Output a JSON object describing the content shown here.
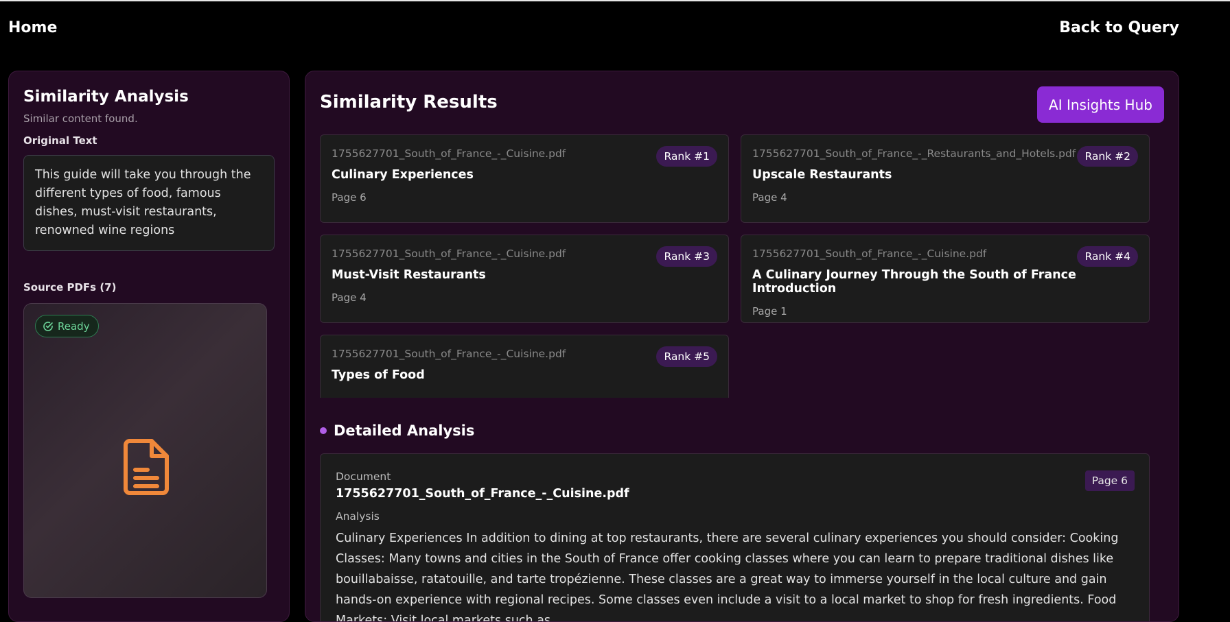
{
  "nav": {
    "home": "Home",
    "back": "Back to Query"
  },
  "left": {
    "title": "Similarity Analysis",
    "subtitle": "Similar content found.",
    "original_label": "Original Text",
    "original_text": "This guide will take you through the different types of food, famous dishes, must-visit restaurants, renowned wine regions",
    "sources_label": "Source PDFs (7)",
    "status": "Ready",
    "icon": "document-icon",
    "icon_color": "#f0883a"
  },
  "right": {
    "title": "Similarity Results",
    "ai_button": "AI Insights Hub",
    "results": [
      {
        "file": "1755627701_South_of_France_-_Cuisine.pdf",
        "title": "Culinary Experiences",
        "page": "Page 6",
        "rank": "Rank #1"
      },
      {
        "file": "1755627701_South_of_France_-_Restaurants_and_Hotels.pdf",
        "title": "Upscale Restaurants",
        "page": "Page 4",
        "rank": "Rank #2"
      },
      {
        "file": "1755627701_South_of_France_-_Cuisine.pdf",
        "title": "Must-Visit Restaurants",
        "page": "Page 4",
        "rank": "Rank #3"
      },
      {
        "file": "1755627701_South_of_France_-_Cuisine.pdf",
        "title": "A Culinary Journey Through the South of France Introduction",
        "page": "Page 1",
        "rank": "Rank #4"
      },
      {
        "file": "1755627701_South_of_France_-_Cuisine.pdf",
        "title": "Types of Food",
        "page": "",
        "rank": "Rank #5"
      }
    ],
    "detailed": {
      "heading": "Detailed Analysis",
      "doc_label": "Document",
      "doc_name": "1755627701_South_of_France_-_Cuisine.pdf",
      "page": "Page 6",
      "analysis_label": "Analysis",
      "text": "Culinary Experiences In addition to dining at top restaurants, there are several culinary experiences you should consider: Cooking Classes: Many towns and cities in the South of France offer cooking classes where you can learn to prepare traditional dishes like bouillabaisse, ratatouille, and tarte tropézienne. These classes are a great way to immerse yourself in the local culture and gain hands-on experience with regional recipes. Some classes even include a visit to a local market to shop for fresh ingredients. Food Markets: Visit local markets such as"
    }
  },
  "colors": {
    "accent": "#8a2bd4",
    "panel": "#220a22",
    "card": "#1c1c1c",
    "ready": "#6ed69a"
  }
}
